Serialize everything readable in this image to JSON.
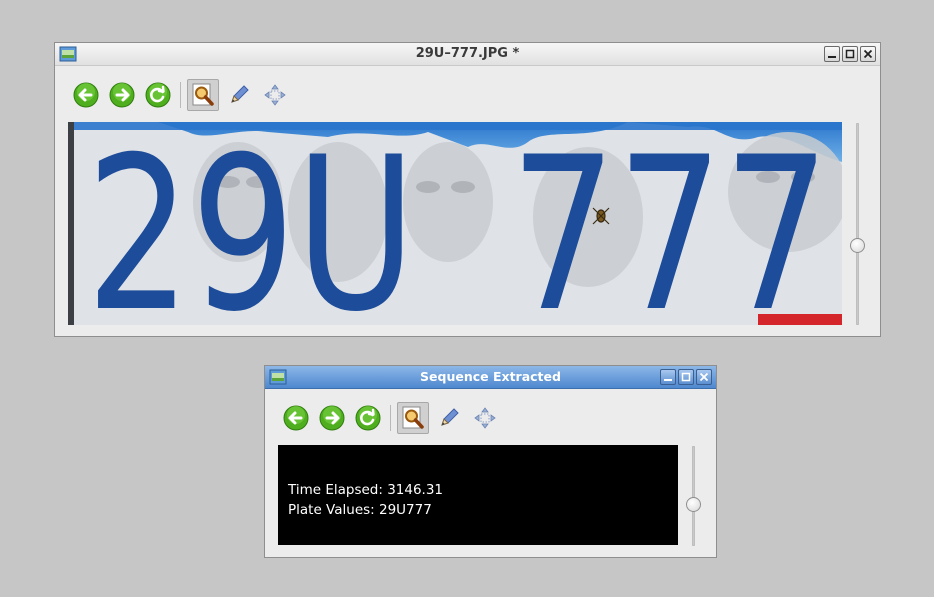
{
  "main_window": {
    "title": "29U–777.JPG *",
    "plate_image": {
      "description_icon": "license-plate-photo",
      "characters": "29U 777",
      "colors": {
        "text": "#1d4c9a",
        "sky": "#2f7fd0",
        "plate": "#dcdfe2"
      }
    }
  },
  "result_window": {
    "title": "Sequence Extracted",
    "output": {
      "time_label": "Time Elapsed: 3146.31",
      "plate_label": "Plate Values: 29U777"
    }
  },
  "toolbar": {
    "buttons": [
      {
        "icon": "back-arrow-icon"
      },
      {
        "icon": "forward-arrow-icon"
      },
      {
        "icon": "refresh-icon"
      },
      {
        "icon": "zoom-magnifier-icon",
        "active": true
      },
      {
        "icon": "pencil-icon"
      },
      {
        "icon": "move-arrows-icon"
      }
    ]
  },
  "window_controls": [
    "minimize-icon",
    "maximize-icon",
    "close-icon"
  ],
  "sliders": {
    "main_level": 0.5,
    "result_level": 0.6
  }
}
